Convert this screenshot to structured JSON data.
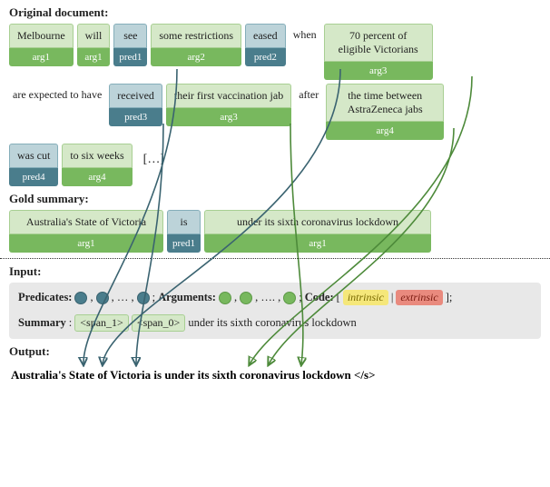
{
  "section_labels": {
    "original": "Original document:",
    "gold": "Gold summary:",
    "input": "Input:",
    "output": "Output:"
  },
  "doc": {
    "row1": [
      {
        "text": "Melbourne",
        "role": "arg1",
        "kind": "arg"
      },
      {
        "text": "will",
        "role": "arg1",
        "kind": "arg"
      },
      {
        "text": "see",
        "role": "pred1",
        "kind": "pred"
      },
      {
        "text": "some restrictions",
        "role": "arg2",
        "kind": "arg"
      },
      {
        "text": "eased",
        "role": "pred2",
        "kind": "pred"
      },
      {
        "text": "when",
        "kind": "plain"
      },
      {
        "text": "70 percent of eligible Victorians",
        "role": "arg3",
        "kind": "arg"
      }
    ],
    "row2": [
      {
        "text": "are expected to have",
        "kind": "plain"
      },
      {
        "text": "received",
        "role": "pred3",
        "kind": "pred"
      },
      {
        "text": "their first vaccination jab",
        "role": "arg3",
        "kind": "arg"
      },
      {
        "text": "after",
        "kind": "plain"
      },
      {
        "text": "the time between AstraZeneca jabs",
        "role": "arg4",
        "kind": "arg"
      }
    ],
    "row3": [
      {
        "text": "was cut",
        "role": "pred4",
        "kind": "pred"
      },
      {
        "text": "to six weeks",
        "role": "arg4",
        "kind": "arg"
      },
      {
        "text": "[…]",
        "kind": "ellipsis"
      }
    ]
  },
  "gold": [
    {
      "text": "Australia's State of Victoria",
      "role": "arg1",
      "kind": "arg"
    },
    {
      "text": "is",
      "role": "pred1",
      "kind": "pred"
    },
    {
      "text": "under its sixth coronavirus lockdown",
      "role": "arg1",
      "kind": "arg"
    }
  ],
  "input_block": {
    "pred_label": "Predicates:",
    "arg_label": "Arguments:",
    "code_label": "Code:",
    "intrinsic": "intrinsic",
    "extrinsic": "extrinsic",
    "summary_label": "Summary",
    "span1": "<span_1>",
    "span0": "<span_0>",
    "summary_tail": "under its sixth coronavirus lockdown"
  },
  "output_text": "Australia's State of Victoria is under its sixth coronavirus lockdown </s>",
  "sep": {
    "comma": ",",
    "ellipsis_comma": ", … ,",
    "ellipsis_comma2": ", …. ,",
    "semicolon": ";",
    "bracket_open": "[",
    "bracket_close": "];",
    "pipe": "|",
    "colon": ":"
  }
}
